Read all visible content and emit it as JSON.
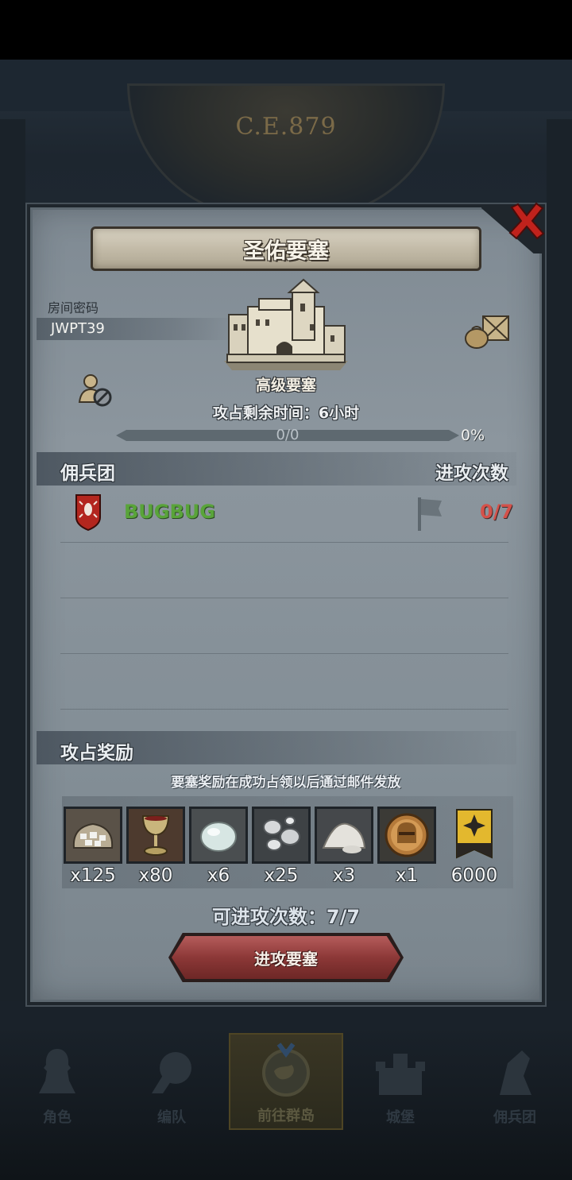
{
  "background": {
    "year": "C.E.879"
  },
  "dialog": {
    "title": "圣佑要塞",
    "room_label": "房间密码",
    "room_code": "JWPT39",
    "fortress_level": "高级要塞",
    "remain_time": "攻占剩余时间：6小时",
    "progress": {
      "text": "0/0",
      "percent_text": "0%",
      "fraction": 0
    },
    "mercenary_header": {
      "left": "佣兵团",
      "right": "进攻次数"
    },
    "guild_rows": [
      {
        "name": "BUGBUG",
        "attacks": "0/7"
      }
    ],
    "reward_header": "攻占奖励",
    "reward_note": "要塞奖励在成功占领以后通过邮件发放",
    "rewards": [
      {
        "icon": "silver-ore-sack-icon",
        "qty": "x125"
      },
      {
        "icon": "goblet-icon",
        "qty": "x80"
      },
      {
        "icon": "moonstone-icon",
        "qty": "x6"
      },
      {
        "icon": "mercury-drops-icon",
        "qty": "x25"
      },
      {
        "icon": "salt-pile-icon",
        "qty": "x3"
      },
      {
        "icon": "knight-helmet-coin-icon",
        "qty": "x1"
      },
      {
        "icon": "guild-banner-icon",
        "qty": "6000"
      }
    ],
    "attacks_available": "可进攻次数：7/7",
    "attack_button": "进攻要塞"
  },
  "bottom_nav": [
    {
      "label": "角色",
      "icon": "knight-icon",
      "active": false
    },
    {
      "label": "编队",
      "icon": "helmet-formation-icon",
      "active": false
    },
    {
      "label": "前往群岛",
      "icon": "compass-map-icon",
      "active": true
    },
    {
      "label": "城堡",
      "icon": "castle-icon",
      "active": false
    },
    {
      "label": "佣兵团",
      "icon": "mercenary-icon",
      "active": false
    }
  ],
  "colors": {
    "guild_name": "#59a43a",
    "attack_count": "#d4514a",
    "button": "#8c3837"
  }
}
